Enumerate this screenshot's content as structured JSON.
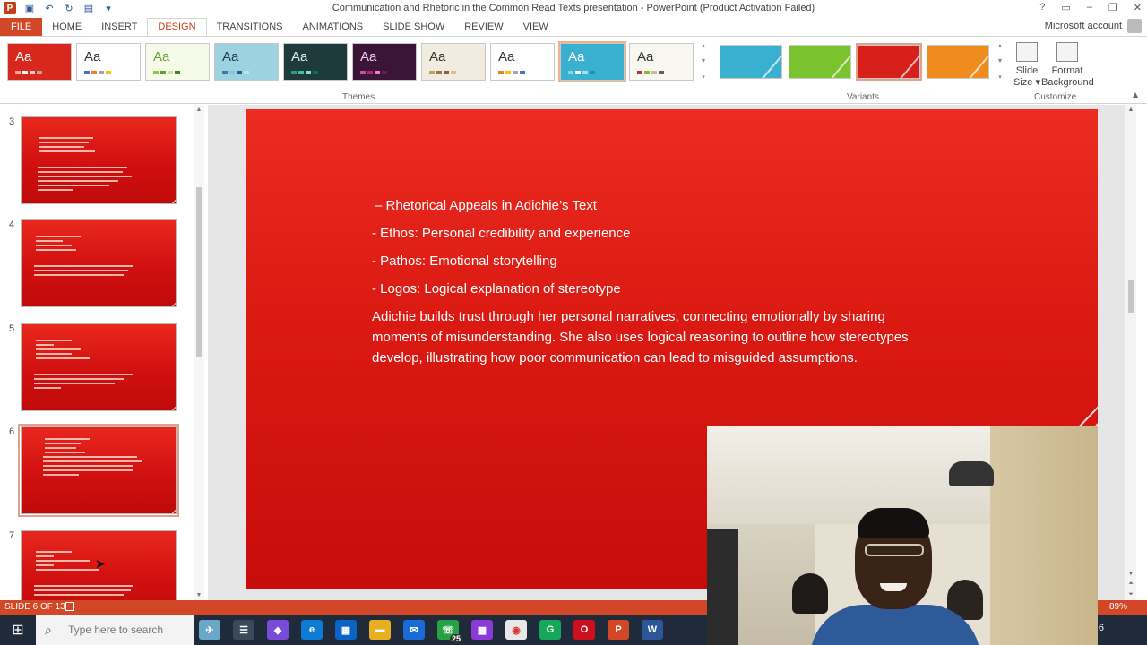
{
  "window": {
    "title": "Communication and Rhetoric in the Common Read Texts presentation - PowerPoint (Product Activation Failed)",
    "help": "?",
    "minimize": "–",
    "restore": "❐",
    "close": "✕"
  },
  "ribbon": {
    "tabs": [
      "FILE",
      "HOME",
      "INSERT",
      "DESIGN",
      "TRANSITIONS",
      "ANIMATIONS",
      "SLIDE SHOW",
      "REVIEW",
      "VIEW"
    ],
    "account": "Microsoft account",
    "themes_label": "Themes",
    "variants_label": "Variants",
    "customize_label": "Customize",
    "theme_sample": "Aa",
    "slide_size": "Slide\nSize ▾",
    "format_background": "Format\nBackground",
    "themes": [
      {
        "bg": "#d8281e",
        "fg": "#ffffff",
        "bars": [
          "#f4a6a0",
          "#ffffff",
          "#ffd0c8",
          "#c8a0a0"
        ]
      },
      {
        "bg": "#ffffff",
        "fg": "#333333",
        "bars": [
          "#4472c4",
          "#ed7d31",
          "#a5a5a5",
          "#ffc000"
        ]
      },
      {
        "bg": "#f5fbe8",
        "fg": "#6aa032",
        "bars": [
          "#8dc63f",
          "#60a030",
          "#c8e6a0",
          "#40802a"
        ]
      },
      {
        "bg": "#9dd3e0",
        "fg": "#1f3a5a",
        "bars": [
          "#3a78a8",
          "#90c0e0",
          "#2060a0",
          "#c0e0f0"
        ]
      },
      {
        "bg": "#1e3a3a",
        "fg": "#e0f0ea",
        "bars": [
          "#2aa080",
          "#40c0a0",
          "#80e0c0",
          "#1a6a5a"
        ]
      },
      {
        "bg": "#3a1538",
        "fg": "#f0d0ee",
        "bars": [
          "#d04aa0",
          "#a02a80",
          "#f080c0",
          "#6a1a5a"
        ]
      },
      {
        "bg": "#f1ece0",
        "fg": "#333333",
        "bars": [
          "#c0a060",
          "#a07040",
          "#806040",
          "#e0c080"
        ]
      },
      {
        "bg": "#ffffff",
        "fg": "#333333",
        "bars": [
          "#ed7d31",
          "#ffc000",
          "#a5a5a5",
          "#4472c4"
        ]
      },
      {
        "bg": "#3ab0d0",
        "fg": "#ffffff",
        "bars": [
          "#80d8f0",
          "#ffffff",
          "#a0e0f0",
          "#2090b0"
        ]
      },
      {
        "bg": "#f8f8f0",
        "fg": "#333333",
        "bars": [
          "#c03030",
          "#90b040",
          "#c0c0a0",
          "#606060"
        ]
      }
    ],
    "variants": [
      {
        "color": "#3ab0d0"
      },
      {
        "color": "#7ac22e"
      },
      {
        "color": "#d8201a"
      },
      {
        "color": "#f08c1e"
      }
    ]
  },
  "thumbnails": [
    {
      "number": "3",
      "active": false
    },
    {
      "number": "4",
      "active": false
    },
    {
      "number": "5",
      "active": false
    },
    {
      "number": "6",
      "active": true
    },
    {
      "number": "7",
      "active": false
    }
  ],
  "slide": {
    "bullets": [
      "– Rhetorical Appeals in Adichie’s Text",
      "- Ethos: Personal credibility and experience",
      "- Pathos: Emotional storytelling",
      "- Logos: Logical explanation of stereotype"
    ],
    "paragraph": "Adichie builds trust through her personal narratives, connecting emotionally by sharing moments of misunderstanding. She also uses logical reasoning to outline how stereotypes develop, illustrating how poor communication can lead to misguided assumptions."
  },
  "status": {
    "slide_indicator": "SLIDE 6 OF 13",
    "zoom": "89%"
  },
  "taskbar": {
    "search_placeholder": "Type here to search",
    "badge": "25",
    "clock_partial": "6"
  }
}
